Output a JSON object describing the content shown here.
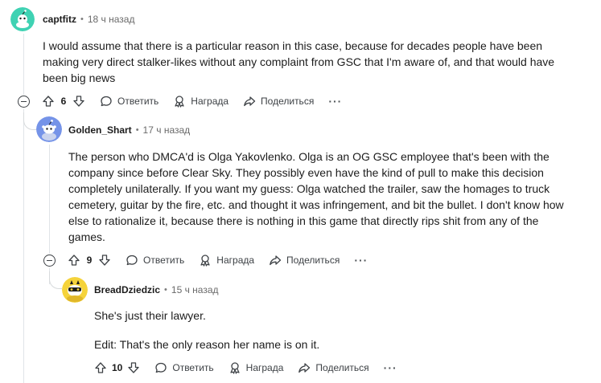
{
  "comments": [
    {
      "author": "captfitz",
      "time": "18 ч назад",
      "paragraphs": [
        "I would assume that there is a particular reason in this case, because for decades people have been making very direct stalker-likes without any complaint from GSC that I'm aware of, and that would have been big news"
      ],
      "votes": "6"
    },
    {
      "author": "Golden_Shart",
      "time": "17 ч назад",
      "paragraphs": [
        "The person who DMCA'd is Olga Yakovlenko. Olga is an OG GSC employee that's been with the company since before Clear Sky. They possibly even have the kind of pull to make this decision completely unilaterally. If you want my guess: Olga watched the trailer, saw the homages to truck cemetery, guitar by the fire, etc. and thought it was infringement, and bit the bullet. I don't know how else to rationalize it, because there is nothing in this game that directly rips shit from any of the games."
      ],
      "votes": "9"
    },
    {
      "author": "BreadDziedzic",
      "time": "15 ч назад",
      "paragraphs": [
        "She's just their lawyer.",
        "Edit: That's the only reason her name is on it."
      ],
      "votes": "10"
    }
  ],
  "actions": {
    "reply": "Ответить",
    "award": "Награда",
    "share": "Поделиться",
    "more": "···"
  },
  "colors": {
    "avatar1": "#3fd2b3",
    "avatar2": "#7593e8",
    "avatar3": "#f5d33b"
  }
}
